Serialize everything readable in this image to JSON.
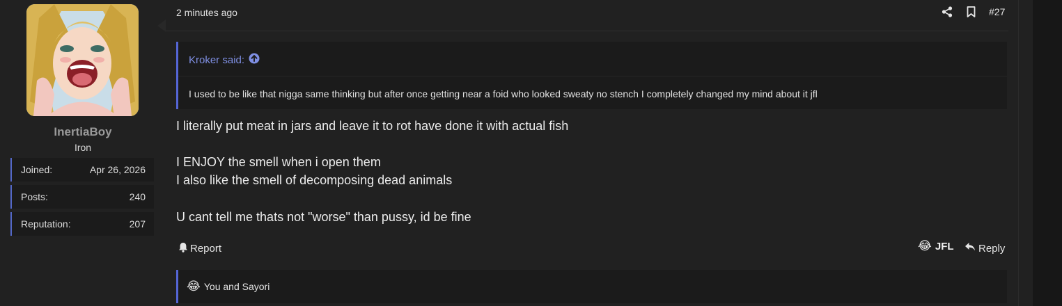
{
  "user": {
    "name": "InertiaBoy",
    "title": "Iron",
    "stats": [
      {
        "label": "Joined:",
        "value": "Apr 26, 2026"
      },
      {
        "label": "Posts:",
        "value": "240"
      },
      {
        "label": "Reputation:",
        "value": "207"
      }
    ]
  },
  "post": {
    "time": "2 minutes ago",
    "number": "#27",
    "quote": {
      "author": "Kroker said:",
      "text": "I used to be like that nigga same thinking but after once getting near a foid who looked sweaty no stench I completely changed my mind about it jfl"
    },
    "lines": [
      "I literally put meat in jars and leave it to rot have done it with actual fish",
      "I ENJOY the smell when i open them",
      "I also like the smell of decomposing dead animals",
      "U cant tell me thats not \"worse\" than pussy, id be fine"
    ],
    "actions": {
      "report": "Report",
      "reaction": "JFL",
      "reply": "Reply"
    },
    "reactions_summary": "You and Sayori",
    "reaction_emoji": "😂"
  },
  "colors": {
    "accent": "#5566d6",
    "quote_author": "#7f8fe3",
    "username": "#9a9a9a"
  },
  "icons": [
    "share-icon",
    "bookmark-icon",
    "up-arrow-circle-icon",
    "bell-icon",
    "reply-arrow-icon"
  ]
}
